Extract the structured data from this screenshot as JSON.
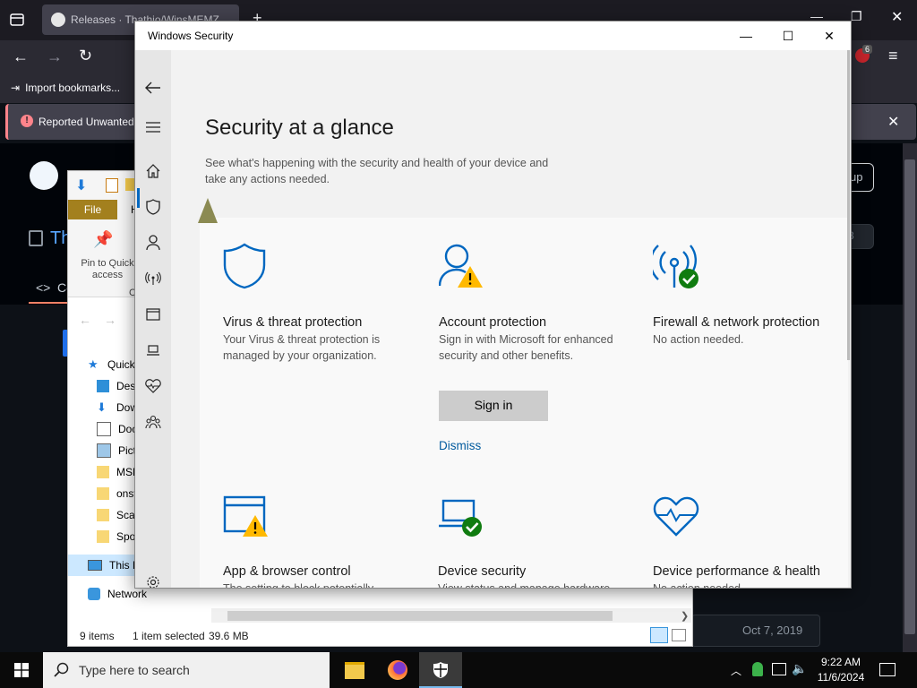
{
  "browser": {
    "tab_title": "Releases · Thathio/WinsMEMZ",
    "bookmarks_label": "Import bookmarks...",
    "notice_text": "Reported Unwanted",
    "signup_label": "up",
    "repo_fragment": "Th",
    "code_tab_fragment": "Co",
    "count_fragment": "8",
    "release_date": "Oct 7, 2019",
    "extension_badge": "6"
  },
  "explorer": {
    "file_tab": "File",
    "home_tab_fragment": "H",
    "pin_label": "Pin to Quick access",
    "copy_fragment": "C",
    "nav_items": [
      {
        "label": "Quick",
        "icon": "star-icon"
      },
      {
        "label": "Desk",
        "icon": "desktop-folder-icon"
      },
      {
        "label": "Dow",
        "icon": "downloads-icon"
      },
      {
        "label": "Doc",
        "icon": "documents-icon"
      },
      {
        "label": "Pict",
        "icon": "pictures-icon"
      },
      {
        "label": "MSN",
        "icon": "folder-icon"
      },
      {
        "label": "onst",
        "icon": "folder-icon"
      },
      {
        "label": "Scar",
        "icon": "folder-icon"
      },
      {
        "label": "Spo",
        "icon": "folder-icon"
      },
      {
        "label": "This P",
        "icon": "this-pc-icon"
      },
      {
        "label": "Network",
        "icon": "network-icon"
      }
    ],
    "status_items": "9 items",
    "status_selected": "1 item selected",
    "status_size": "39.6 MB"
  },
  "window": {
    "title": "Windows Security",
    "minimize": "—",
    "maximize": "☐",
    "close": "✕"
  },
  "page": {
    "title": "Security at a glance",
    "subtitle": "See what's happening with the security and health of your device and take any actions needed."
  },
  "cards": [
    {
      "title": "Virus & threat protection",
      "desc": "Your Virus & threat protection is managed by your organization.",
      "icon": "shield-icon",
      "status": "none"
    },
    {
      "title": "Account protection",
      "desc": "Sign in with Microsoft for enhanced security and other benefits.",
      "icon": "account-icon",
      "status": "warning"
    },
    {
      "title": "Firewall & network protection",
      "desc": "No action needed.",
      "icon": "firewall-icon",
      "status": "ok"
    },
    {
      "title": "App & browser control",
      "desc": "The setting to block potentially unwanted apps is turned off.",
      "icon": "app-browser-icon",
      "status": "warning"
    },
    {
      "title": "Device security",
      "desc": "View status and manage hardware security features",
      "icon": "device-security-icon",
      "status": "ok"
    },
    {
      "title": "Device performance & health",
      "desc": "No action needed.",
      "icon": "health-icon",
      "status": "none"
    }
  ],
  "actions": {
    "sign_in": "Sign in",
    "dismiss": "Dismiss"
  },
  "taskbar": {
    "search_placeholder": "Type here to search",
    "time": "9:22 AM",
    "date": "11/6/2024"
  },
  "colors": {
    "accent": "#0067c0",
    "warning": "#ffb900",
    "ok": "#107c10",
    "file_tab": "#a3801e"
  }
}
